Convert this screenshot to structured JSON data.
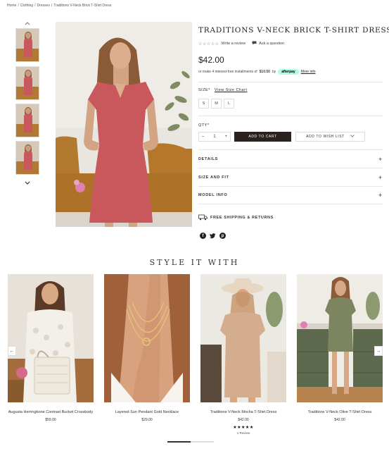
{
  "breadcrumb": {
    "items": [
      "Home",
      "Clothing",
      "Dresses",
      "Traditions V-Neck Brick T-Shirt Dress"
    ],
    "separator": "/"
  },
  "gallery": {
    "thumb_count": 4,
    "up_icon": "chevron-up-icon",
    "down_icon": "chevron-down-icon"
  },
  "product": {
    "title": "Traditions V-Neck Brick T-Shirt Dress",
    "stars": "☆☆☆☆☆",
    "write_review": "Write a review",
    "ask_question": "Ask a question",
    "price": "$42.00",
    "installments_text": "or make 4 interest-free installments of",
    "installment_amount": "$10.50",
    "installment_by": "by",
    "afterpay_label": "afterpay",
    "more_info": "More info",
    "size_label": "SIZE",
    "size_required": "*",
    "size_chart": "View Size Chart",
    "sizes": [
      "S",
      "M",
      "L"
    ],
    "qty_label": "QTY",
    "qty_required": "*",
    "qty_value": "1",
    "qty_minus": "–",
    "qty_plus": "+",
    "add_to_cart": "ADD TO CART",
    "add_to_wishlist": "ADD TO WISH LIST",
    "accordions": [
      "DETAILS",
      "SIZE AND FIT",
      "MODEL INFO"
    ],
    "accordion_icon": "+",
    "shipping": "FREE SHIPPING & RETURNS",
    "social": [
      "facebook-icon",
      "twitter-icon",
      "pinterest-icon"
    ],
    "colors": {
      "dress": "#c9585c",
      "cart_button": "#2b2220",
      "afterpay": "#b2fce4"
    }
  },
  "style_with": {
    "title": "STYLE IT WITH",
    "left_arrow": "←",
    "right_arrow": "→",
    "items": [
      {
        "name": "Augusta Herringbone Contrast Bucket Crossbody",
        "price": "$59.00"
      },
      {
        "name": "Layered Sun Pendant Gold Necklace",
        "price": "$29.00"
      },
      {
        "name": "Traditions V-Neck Mocha T-Shirt Dress",
        "price": "$42.00",
        "stars": "★★★★★",
        "reviews": "1 Review"
      },
      {
        "name": "Traditions V-Neck Olive T-Shirt Dress",
        "price": "$42.00"
      }
    ]
  }
}
